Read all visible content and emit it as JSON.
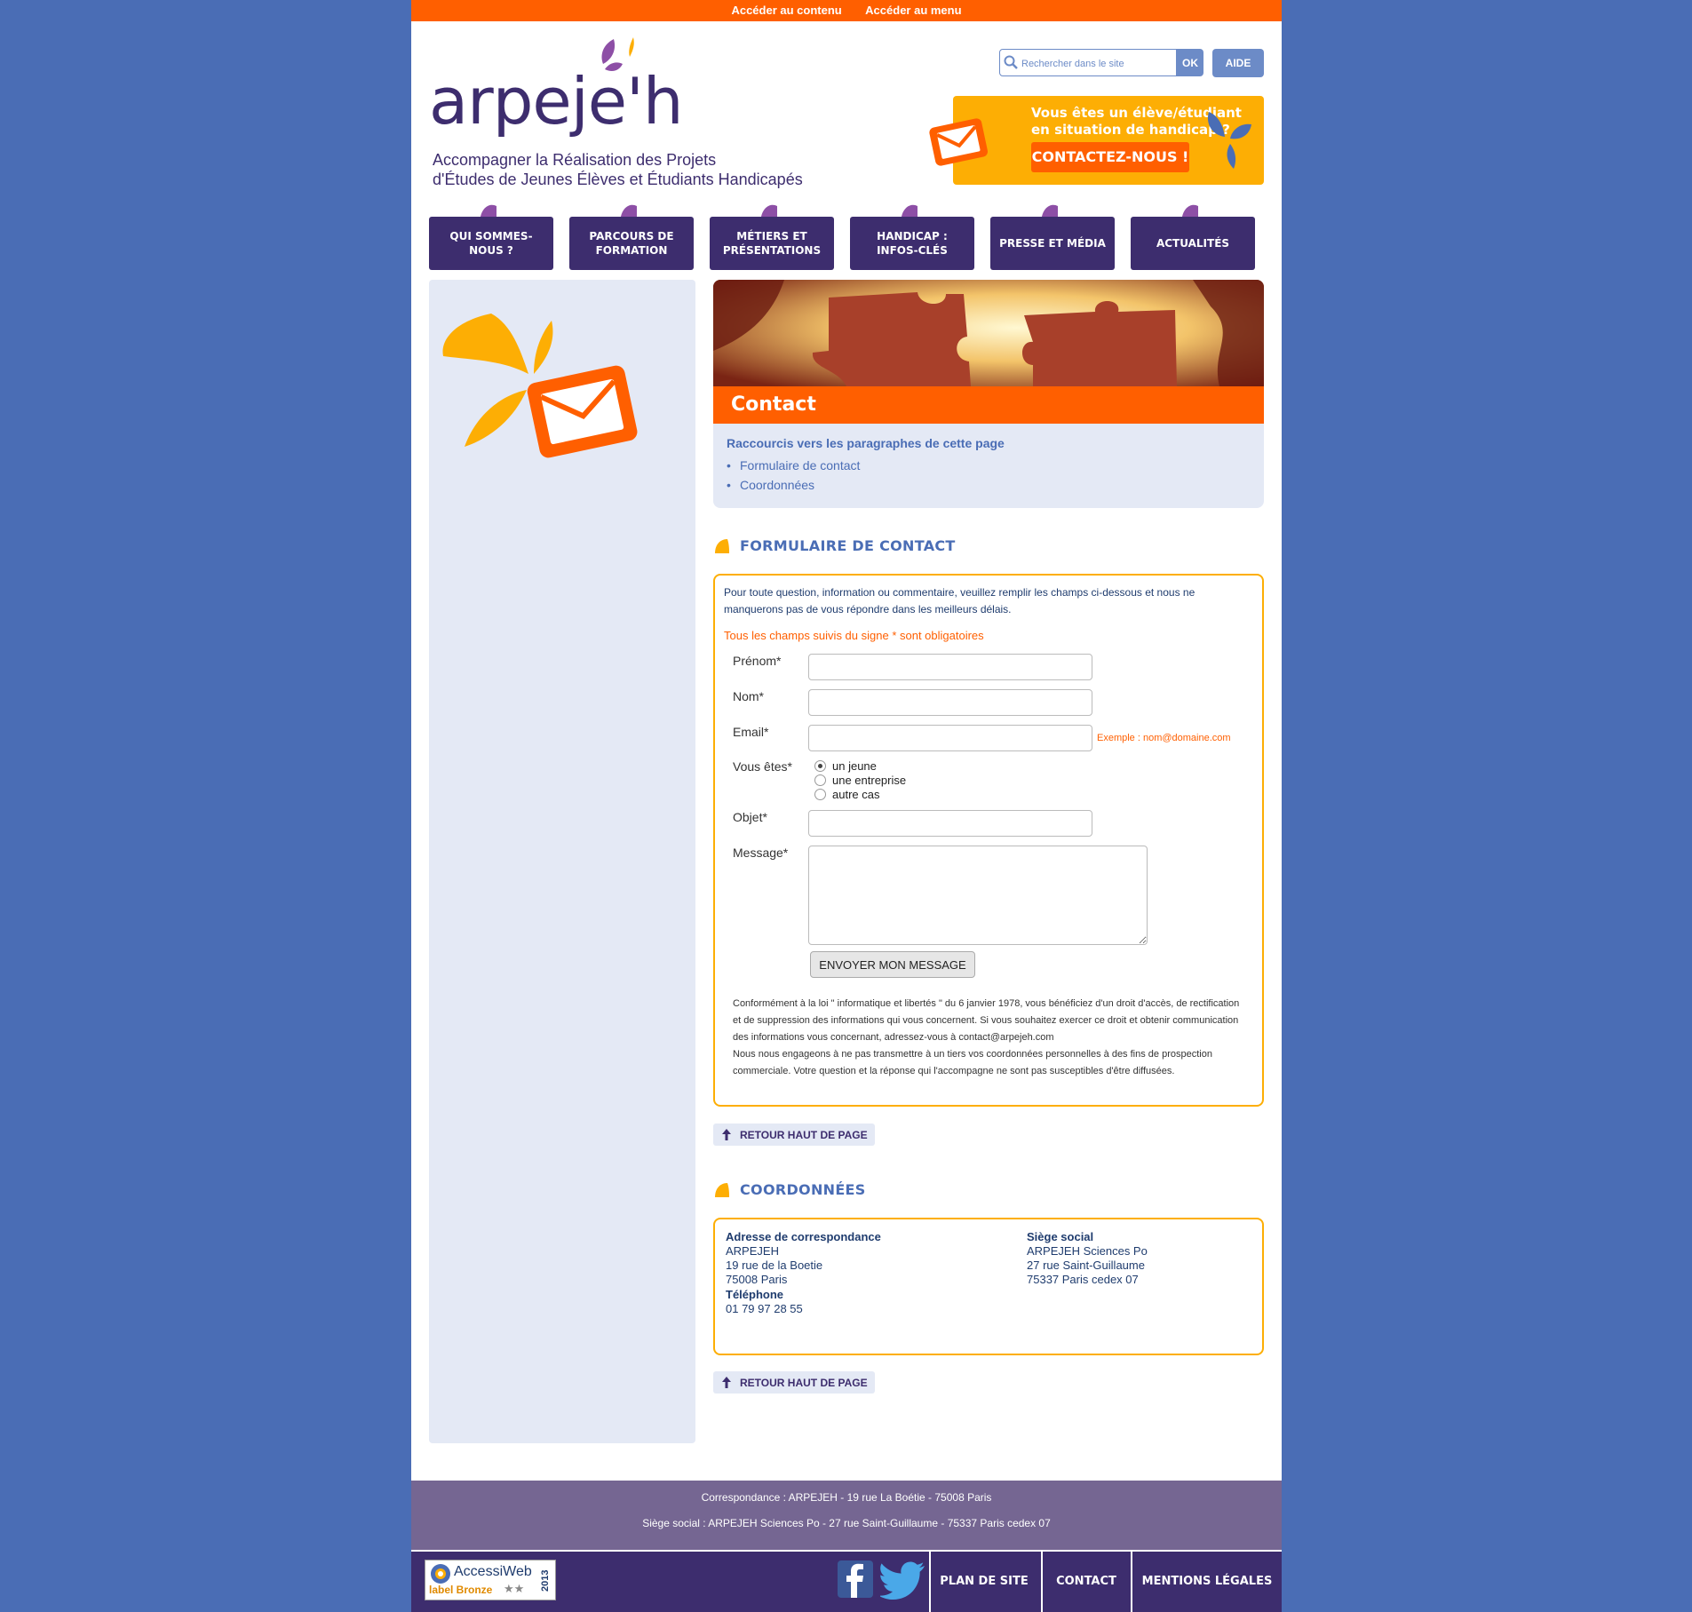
{
  "skip_links": [
    "Accéder au contenu",
    "Accéder au menu"
  ],
  "logo": {
    "wordmark": "arpeje'h",
    "tagline_1": "Accompagner la Réalisation des Projets",
    "tagline_2": "d'Études de Jeunes Élèves et Étudiants Handicapés"
  },
  "search": {
    "placeholder": "Rechercher dans le site",
    "submit_label": "OK",
    "help_label": "AIDE"
  },
  "banner": {
    "line_1": "Vous êtes un élève/étudiant",
    "line_2": "en situation de handicap ?",
    "cta_label": "CONTACTEZ-NOUS !"
  },
  "nav": {
    "items": [
      {
        "label": "QUI SOMMES-NOUS ?"
      },
      {
        "label": "PARCOURS DE FORMATION"
      },
      {
        "label": "MÉTIERS ET PRÉSENTATIONS"
      },
      {
        "label": "HANDICAP : INFOS-CLÉS"
      },
      {
        "label": "PRESSE ET MÉDIA"
      },
      {
        "label": "ACTUALITÉS"
      }
    ]
  },
  "hero": {
    "title": "Contact"
  },
  "shortcuts": {
    "title": "Raccourcis vers les paragraphes de cette page",
    "links": [
      "Formulaire de contact",
      "Coordonnées"
    ]
  },
  "form": {
    "heading": "FORMULAIRE DE CONTACT",
    "intro": "Pour toute question, information ou commentaire, veuillez remplir les champs ci-dessous et nous ne manquerons pas de vous répondre dans les meilleurs délais.",
    "required_note": "Tous les champs suivis du signe * sont obligatoires",
    "labels": {
      "first_name": "Prénom*",
      "last_name": "Nom*",
      "email": "Email*",
      "you_are": "Vous êtes*",
      "subject": "Objet*",
      "message": "Message*"
    },
    "email_hint": "Exemple : nom@domaine.com",
    "values": {
      "first_name": "",
      "last_name": "",
      "email": "",
      "subject": "",
      "message": ""
    },
    "radio_options": [
      "un jeune",
      "une entreprise",
      "autre cas"
    ],
    "radio_selected": "un jeune",
    "submit_label": "ENVOYER MON MESSAGE",
    "legal_1": "Conformément à la loi \" informatique et libertés \" du 6 janvier 1978, vous bénéficiez d'un droit d'accès, de rectification et de suppression des informations qui vous concernent. Si vous souhaitez exercer ce droit et obtenir communication des informations vous concernant, adressez-vous à contact@arpejeh.com",
    "legal_2": "Nous nous engageons à ne pas transmettre à un tiers vos coordonnées personnelles à des fins de prospection commerciale. Votre question et la réponse qui l'accompagne ne sont pas susceptibles d'être diffusées."
  },
  "back_to_top_label": "RETOUR HAUT DE PAGE",
  "coordinates": {
    "heading": "COORDONNÉES",
    "correspondence": {
      "title": "Adresse de correspondance",
      "lines": [
        "ARPEJEH",
        "19 rue de la Boetie",
        "75008 Paris"
      ],
      "phone_title": "Téléphone",
      "phone": "01 79 97 28 55"
    },
    "head_office": {
      "title": "Siège social",
      "lines": [
        "ARPEJEH Sciences Po",
        "27 rue Saint-Guillaume",
        "75337 Paris cedex 07"
      ]
    }
  },
  "footer": {
    "line_1": "Correspondance : ARPEJEH - 19 rue La Boétie - 75008 Paris",
    "line_2": "Siège social : ARPEJEH Sciences Po - 27 rue Saint-Guillaume - 75337 Paris cedex 07",
    "badge": {
      "name": "AccessiWeb",
      "label": "label Bronze",
      "year": "2013"
    },
    "links": [
      "PLAN DE SITE",
      "CONTACT",
      "MENTIONS LÉGALES"
    ]
  },
  "colors": {
    "page_bg": "#4a6db5",
    "orange": "#ff5f00",
    "yellow": "#fdae04",
    "purple": "#3d2d6e",
    "blue_text": "#4a6db5",
    "light_panel": "#e4e9f5"
  },
  "icons": [
    "search-icon",
    "envelope-icon",
    "petals-icon",
    "arrow-up-icon",
    "facebook-icon",
    "twitter-icon",
    "radio-icon"
  ]
}
